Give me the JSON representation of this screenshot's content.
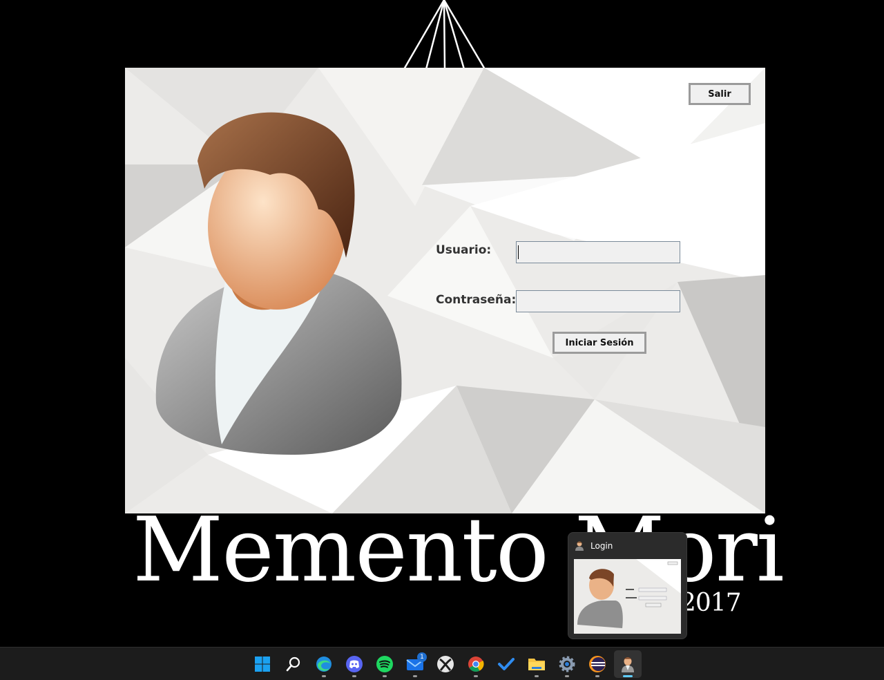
{
  "wallpaper": {
    "title": "Memento Mori",
    "year": "2017"
  },
  "login_window": {
    "exit_label": "Salir",
    "user_label": "Usuario:",
    "password_label": "Contraseña:",
    "user_value": "",
    "password_value": "",
    "submit_label": "Iniciar Sesión"
  },
  "taskbar_preview": {
    "title": "Login"
  },
  "taskbar": {
    "items": [
      {
        "name": "start",
        "icon": "windows-logo-icon"
      },
      {
        "name": "search",
        "icon": "search-icon"
      },
      {
        "name": "edge",
        "icon": "edge-icon"
      },
      {
        "name": "discord",
        "icon": "discord-icon"
      },
      {
        "name": "spotify",
        "icon": "spotify-icon"
      },
      {
        "name": "mail",
        "icon": "mail-icon",
        "badge": "1"
      },
      {
        "name": "xbox",
        "icon": "xbox-icon"
      },
      {
        "name": "chrome",
        "icon": "chrome-icon"
      },
      {
        "name": "todo",
        "icon": "todo-check-icon"
      },
      {
        "name": "file-explorer",
        "icon": "folder-icon"
      },
      {
        "name": "settings",
        "icon": "gear-icon"
      },
      {
        "name": "eclipse",
        "icon": "eclipse-icon"
      },
      {
        "name": "login-app",
        "icon": "user-icon",
        "active": true
      }
    ]
  },
  "colors": {
    "accent": "#60cdff",
    "window_bg": "#efeeec",
    "button_border": "#9b9b9b"
  }
}
